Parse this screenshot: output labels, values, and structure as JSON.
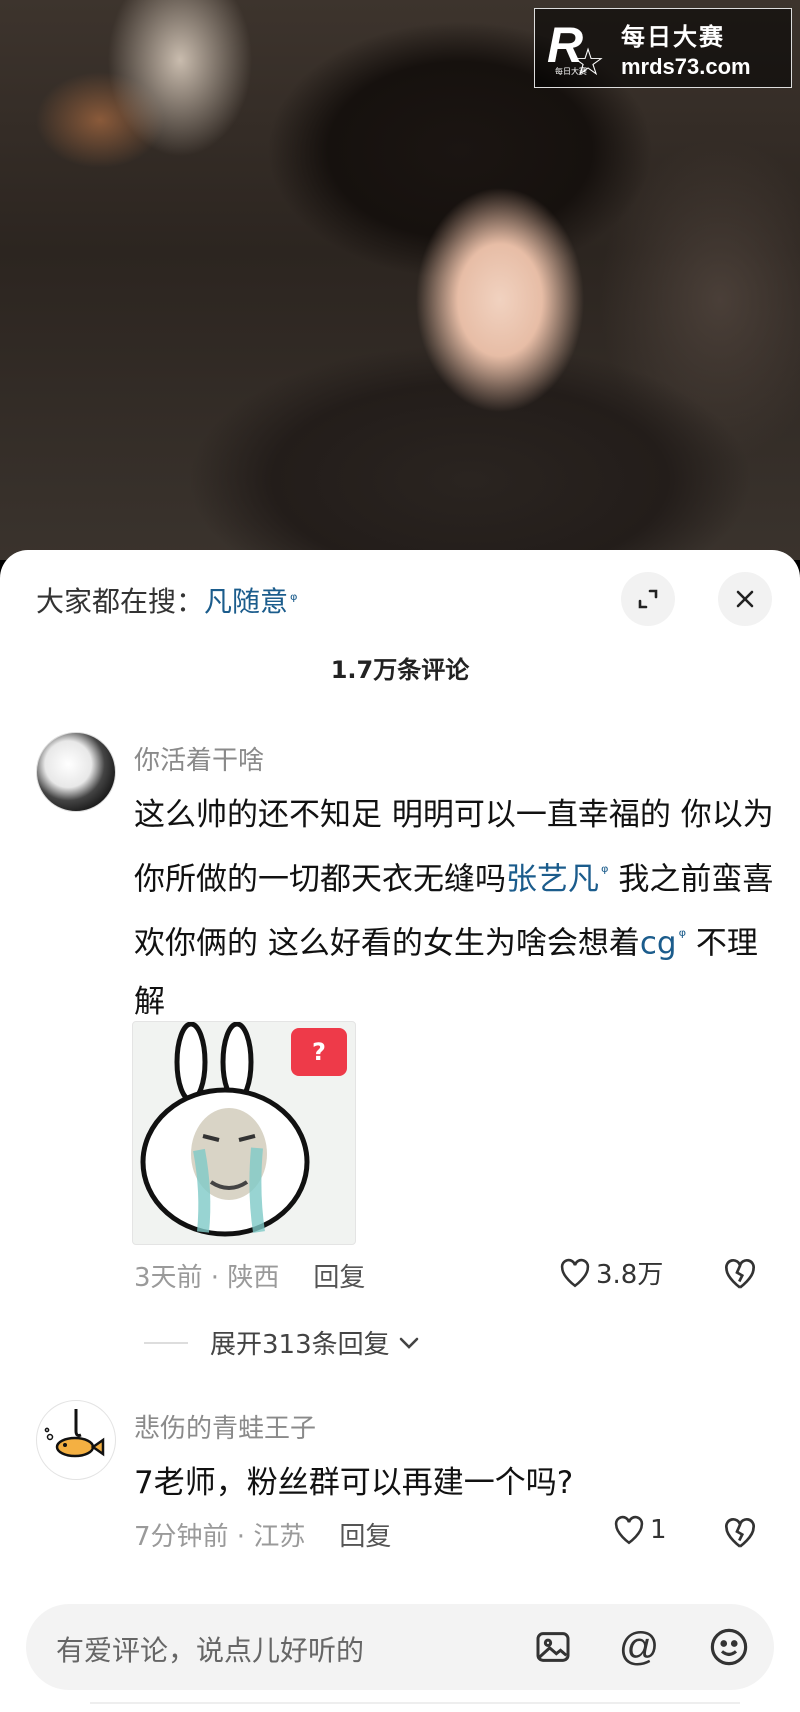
{
  "watermark": {
    "logo_letter": "R",
    "logo_small_text": "每日大赛",
    "name": "每日大赛",
    "url": "mrds73.com"
  },
  "sheet": {
    "trending_prefix": "大家都在搜：",
    "trending_term": "凡随意",
    "comment_count": "1.7万条评论"
  },
  "comments": [
    {
      "author": "你活着干啥",
      "text_part1": "这么帅的还不知足 明明可以一直幸福的 你以为你所做的一切都天衣无缝吗",
      "link1": "张艺凡",
      "text_part2": " 我之前蛮喜欢你俩的 这么好看的女生为啥会想着",
      "link2": "cg",
      "text_part3": " 不理解",
      "sticker_badge": "?",
      "time_location": "3天前 · 陕西",
      "reply_label": "回复",
      "likes": "3.8万",
      "expand_replies": "展开313条回复"
    },
    {
      "author": "悲伤的青蛙王子",
      "text": "7老师，粉丝群可以再建一个吗?",
      "time_location": "7分钟前 · 江苏",
      "reply_label": "回复",
      "likes": "1"
    }
  ],
  "input": {
    "placeholder": "有爱评论，说点儿好听的",
    "icons": [
      "image-icon",
      "at-icon",
      "emoji-icon"
    ]
  },
  "colors": {
    "link": "#1b5c8c",
    "badge": "#ee3a49"
  }
}
